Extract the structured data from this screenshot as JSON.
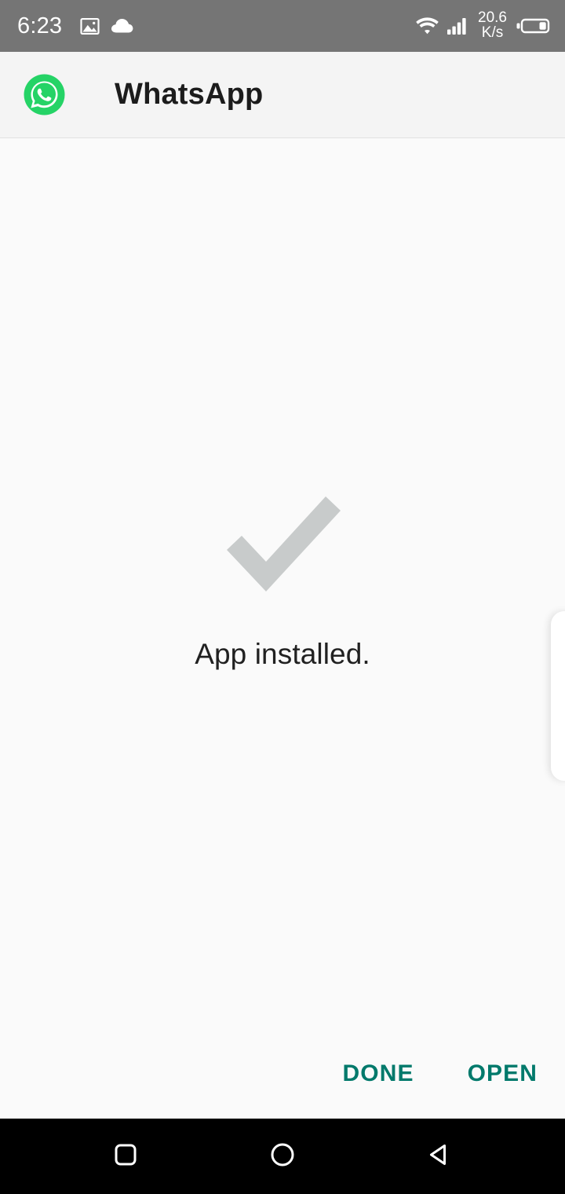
{
  "status_bar": {
    "time": "6:23",
    "left_icons": [
      "image-icon",
      "cloud-icon"
    ],
    "network_speed_value": "20.6",
    "network_speed_unit": "K/s",
    "right_icons": [
      "wifi-icon",
      "cellular-signal-icon",
      "battery-icon"
    ],
    "background_color": "#757575",
    "foreground_color": "#ffffff"
  },
  "app_header": {
    "app_icon": "whatsapp-icon",
    "title": "WhatsApp",
    "background_color": "#f4f4f4",
    "brand_color": "#25d366"
  },
  "main": {
    "status_icon": "checkmark-icon",
    "status_icon_color": "#c8cbcb",
    "status_message": "App installed.",
    "background_color": "#fafafa",
    "edge_panel": "edge-swipe-panel"
  },
  "actions": {
    "accent_color": "#00796b",
    "buttons": [
      {
        "label": "DONE",
        "name": "done-button"
      },
      {
        "label": "OPEN",
        "name": "open-button"
      }
    ]
  },
  "nav_bar": {
    "background_color": "#000000",
    "buttons": [
      {
        "name": "recents-button",
        "icon": "square-icon"
      },
      {
        "name": "home-button",
        "icon": "circle-icon"
      },
      {
        "name": "back-button",
        "icon": "triangle-left-icon"
      }
    ]
  }
}
